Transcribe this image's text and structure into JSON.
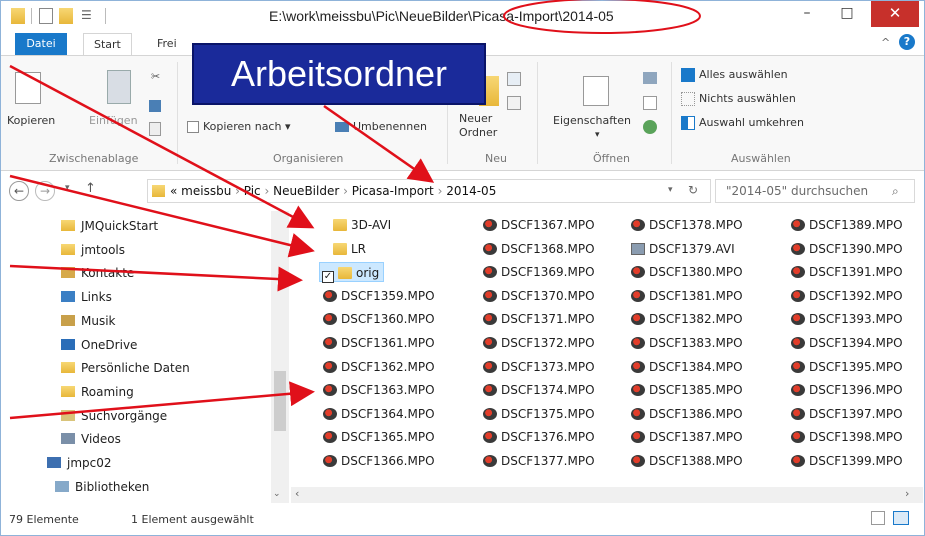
{
  "window": {
    "title": "E:\\work\\meissbu\\Pic\\NeueBilder\\Picasa-Import\\2014-05",
    "minimize": "–",
    "maximize": "□",
    "close": "✕"
  },
  "ribbon_tabs": [
    "Datei",
    "Start",
    "Frei"
  ],
  "ribbon": {
    "clipboard": {
      "copy": "Kopieren",
      "paste": "Einfügen",
      "label": "Zwischenablage"
    },
    "organize": {
      "copy_to": "Kopieren nach",
      "rename": "Umbenennen",
      "label": "Organisieren"
    },
    "new": {
      "new_folder_1": "Neuer",
      "new_folder_2": "Ordner",
      "label": "Neu"
    },
    "open": {
      "properties": "Eigenschaften",
      "label": "Öffnen"
    },
    "select": {
      "all": "Alles auswählen",
      "none": "Nichts auswählen",
      "invert": "Auswahl umkehren",
      "label": "Auswählen"
    }
  },
  "overlay_label": "Arbeitsordner",
  "address": {
    "crumbs": [
      "«",
      "meissbu",
      "Pic",
      "NeueBilder",
      "Picasa-Import",
      "2014-05"
    ],
    "search_placeholder": "\"2014-05\" durchsuchen"
  },
  "nav_pane": [
    {
      "label": "JMQuickStart",
      "icon": "folder-icon"
    },
    {
      "label": "jmtools",
      "icon": "folder-icon"
    },
    {
      "label": "Kontakte",
      "icon": "contacts-icon"
    },
    {
      "label": "Links",
      "icon": "links-icon"
    },
    {
      "label": "Musik",
      "icon": "music-icon"
    },
    {
      "label": "OneDrive",
      "icon": "onedrive-icon"
    },
    {
      "label": "Persönliche Daten",
      "icon": "folder-icon"
    },
    {
      "label": "Roaming",
      "icon": "folder-icon"
    },
    {
      "label": "Suchvorgänge",
      "icon": "search-folder-icon"
    },
    {
      "label": "Videos",
      "icon": "videos-icon"
    },
    {
      "label": "jmpc02",
      "icon": "computer-icon"
    },
    {
      "label": "Bibliotheken",
      "icon": "libraries-icon"
    }
  ],
  "files": {
    "col1": [
      {
        "name": "3D-AVI",
        "type": "folder"
      },
      {
        "name": "LR",
        "type": "folder"
      },
      {
        "name": "orig",
        "type": "folder",
        "selected": true
      },
      {
        "name": "DSCF1359.MPO",
        "type": "mpo"
      },
      {
        "name": "DSCF1360.MPO",
        "type": "mpo"
      },
      {
        "name": "DSCF1361.MPO",
        "type": "mpo"
      },
      {
        "name": "DSCF1362.MPO",
        "type": "mpo"
      },
      {
        "name": "DSCF1363.MPO",
        "type": "mpo"
      },
      {
        "name": "DSCF1364.MPO",
        "type": "mpo"
      },
      {
        "name": "DSCF1365.MPO",
        "type": "mpo"
      },
      {
        "name": "DSCF1366.MPO",
        "type": "mpo"
      }
    ],
    "col2": [
      "DSCF1367.MPO",
      "DSCF1368.MPO",
      "DSCF1369.MPO",
      "DSCF1370.MPO",
      "DSCF1371.MPO",
      "DSCF1372.MPO",
      "DSCF1373.MPO",
      "DSCF1374.MPO",
      "DSCF1375.MPO",
      "DSCF1376.MPO",
      "DSCF1377.MPO"
    ],
    "col3": [
      "DSCF1378.MPO",
      "DSCF1379.AVI",
      "DSCF1380.MPO",
      "DSCF1381.MPO",
      "DSCF1382.MPO",
      "DSCF1383.MPO",
      "DSCF1384.MPO",
      "DSCF1385.MPO",
      "DSCF1386.MPO",
      "DSCF1387.MPO",
      "DSCF1388.MPO"
    ],
    "col4": [
      "DSCF1389.MPO",
      "DSCF1390.MPO",
      "DSCF1391.MPO",
      "DSCF1392.MPO",
      "DSCF1393.MPO",
      "DSCF1394.MPO",
      "DSCF1395.MPO",
      "DSCF1396.MPO",
      "DSCF1397.MPO",
      "DSCF1398.MPO",
      "DSCF1399.MPO"
    ]
  },
  "status": {
    "count": "79 Elemente",
    "selected": "1 Element ausgewählt"
  },
  "colors": {
    "accent": "#1979ca",
    "annotation": "#e0101a",
    "overlay": "#1a2a9a",
    "close": "#c7302b"
  }
}
